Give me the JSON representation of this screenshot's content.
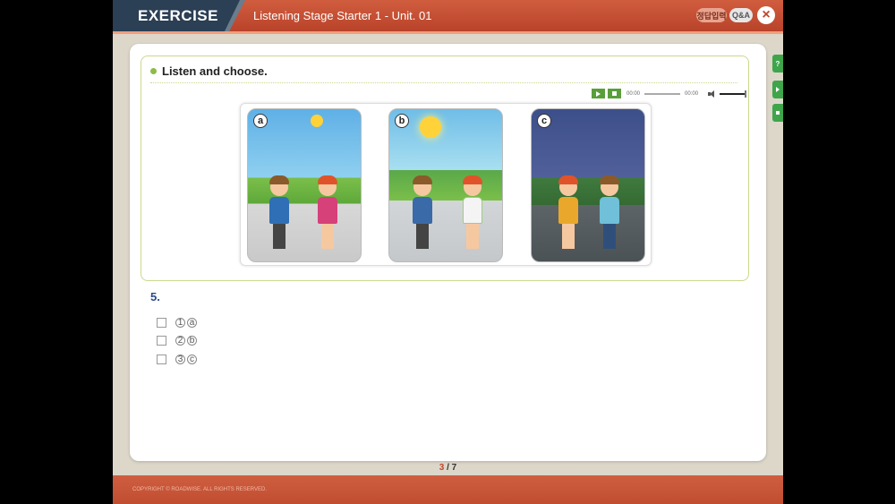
{
  "header": {
    "section": "EXERCISE",
    "title": "Listening Stage Starter 1 - Unit. 01",
    "answer_button": "정답입력",
    "qa_button": "Q&A",
    "close_icon": "close-icon"
  },
  "question": {
    "instruction": "Listen and choose.",
    "player": {
      "current_time": "00:00",
      "total_time": "00:00",
      "progress": 0,
      "volume": 1.0
    },
    "images": [
      {
        "label": "a",
        "scene": "sunny street, boy and girl waving"
      },
      {
        "label": "b",
        "scene": "morning mountain road, boy and girl waving"
      },
      {
        "label": "c",
        "scene": "night street, girl and boy with soccer ball"
      }
    ],
    "number": "5.",
    "options": [
      {
        "num": "1",
        "letter": "a"
      },
      {
        "num": "2",
        "letter": "b"
      },
      {
        "num": "3",
        "letter": "c"
      }
    ]
  },
  "pagination": {
    "current": "3",
    "separator": " / ",
    "total": "7"
  },
  "footer": {
    "copyright": "COPYRIGHT © ROADWISE. ALL RIGHTS RESERVED."
  },
  "side_tabs": {
    "help": "?"
  },
  "colors": {
    "header": "#c44e33",
    "accent_green": "#3ea54b",
    "box_border": "#c9d98b"
  }
}
